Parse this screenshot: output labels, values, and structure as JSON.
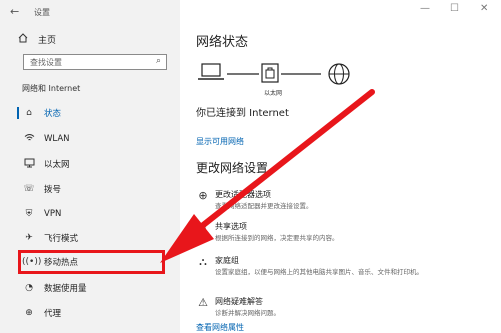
{
  "window": {
    "back_icon": "←",
    "title": "设置",
    "controls": [
      "—",
      "☐",
      "✕"
    ]
  },
  "sidebar": {
    "home": {
      "icon": "home-icon",
      "label": "主页"
    },
    "search": {
      "placeholder": "查找设置",
      "icon": "search-icon"
    },
    "section_label": "网络和 Internet",
    "items": [
      {
        "label": "状态",
        "icon": "home-icon",
        "active": true
      },
      {
        "label": "WLAN",
        "icon": "wifi-icon"
      },
      {
        "label": "以太网",
        "icon": "monitor-icon"
      },
      {
        "label": "拨号",
        "icon": "phone-icon"
      },
      {
        "label": "VPN",
        "icon": "vpn-icon"
      },
      {
        "label": "飞行模式",
        "icon": "airplane-icon"
      },
      {
        "label": "移动热点",
        "icon": "hotspot-icon",
        "highlighted": true
      },
      {
        "label": "数据使用量",
        "icon": "data-usage-icon"
      },
      {
        "label": "代理",
        "icon": "globe-icon"
      }
    ]
  },
  "main": {
    "title": "网络状态",
    "diagram_label": "以太网",
    "status_text": "你已连接到 Internet",
    "show_networks_link": "显示可用网络",
    "change_title": "更改网络设置",
    "options": [
      {
        "icon": "adapter-icon",
        "title": "更改适配器选项",
        "desc": "查看网络适配器并更改连接设置。"
      },
      {
        "icon": "share-icon",
        "title": "共享选项",
        "desc": "根据所连接到的网络，决定要共享的内容。"
      },
      {
        "icon": "homegroup-icon",
        "title": "家庭组",
        "desc": "设置家庭组，以便与网络上的其他电脑共享图片、音乐、文件和打印机。"
      },
      {
        "icon": "warning-icon",
        "title": "网络疑难解答",
        "desc": "诊断并解决网络问题。"
      }
    ],
    "view_properties_link": "查看网络属性"
  },
  "colors": {
    "accent": "#0063b1",
    "annotation": "#e8161b",
    "sidebar_bg": "#f2f2f2"
  }
}
